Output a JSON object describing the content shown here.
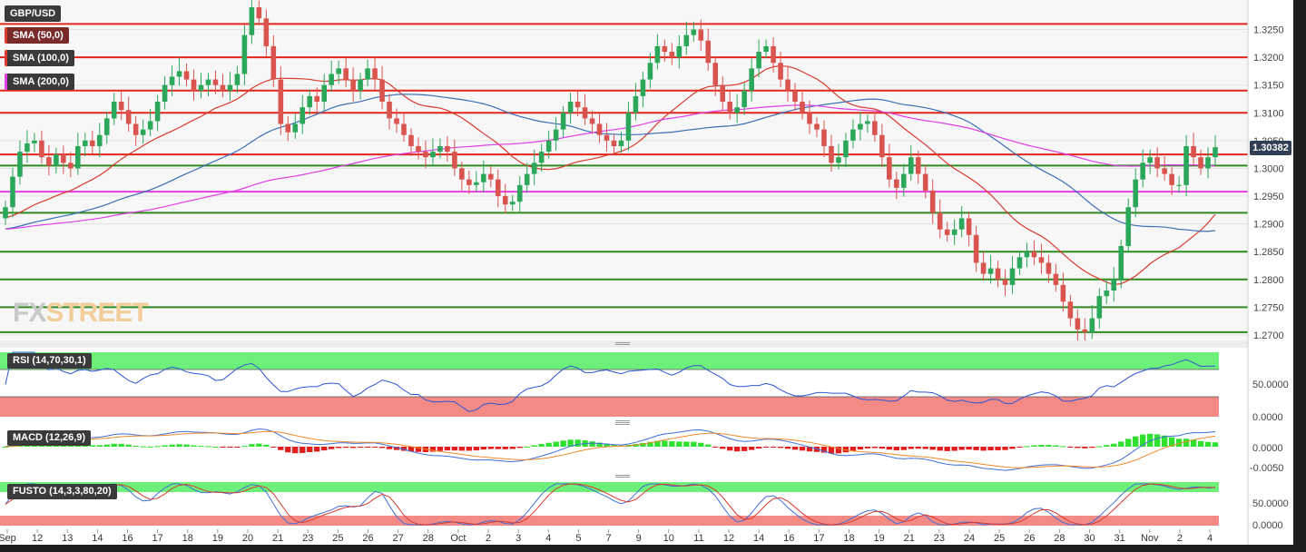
{
  "instrument": "GBP/USD",
  "legend": {
    "sma50": {
      "label": "SMA (50,0)",
      "color": "#d83a2e"
    },
    "sma100": {
      "label": "SMA (100,0)",
      "color": "#3b6fb6"
    },
    "sma200": {
      "label": "SMA (200,0)",
      "color": "#e03ee6"
    }
  },
  "watermark": {
    "part1": "FX",
    "part2": "STREET"
  },
  "last_price": "1.30382",
  "panes": {
    "rsi": {
      "label": "RSI (14,70,30,1)",
      "ticks": [
        "50.0000",
        "0.0000"
      ]
    },
    "macd": {
      "label": "MACD (12,26,9)",
      "ticks": [
        "0.0000",
        "-0.0050"
      ]
    },
    "fusto": {
      "label": "FUSTO (14,3,3,80,20)",
      "ticks": [
        "50.0000",
        "0.0000"
      ]
    }
  },
  "colors": {
    "up": "#2aa75a",
    "down": "#d9534f",
    "hline_red": "#e3261b",
    "hline_green": "#2f8a1f",
    "hline_magenta": "#e53ee0",
    "overbought": "#6cf07a",
    "oversold": "#f38a86",
    "rsi_line": "#2d55d6",
    "macd_line": "#3f6fd8",
    "signal_line": "#f08a2a"
  },
  "chart_data": {
    "type": "candlestick",
    "title": "GBP/USD",
    "ylim": [
      1.2695,
      1.3295
    ],
    "y_ticks": [
      "1.3250",
      "1.3200",
      "1.3150",
      "1.3100",
      "1.3050",
      "1.3000",
      "1.2950",
      "1.2900",
      "1.2850",
      "1.2800",
      "1.2750",
      "1.2700"
    ],
    "x_ticks": [
      "Sep",
      "12",
      "13",
      "14",
      "16",
      "17",
      "18",
      "19",
      "20",
      "21",
      "23",
      "25",
      "26",
      "27",
      "28",
      "Oct",
      "2",
      "3",
      "4",
      "5",
      "7",
      "9",
      "10",
      "11",
      "12",
      "14",
      "16",
      "17",
      "18",
      "19",
      "21",
      "23",
      "24",
      "25",
      "26",
      "28",
      "30",
      "31",
      "Nov",
      "2",
      "4"
    ],
    "horizontal_levels": [
      {
        "value": 1.326,
        "color": "red"
      },
      {
        "value": 1.32,
        "color": "red"
      },
      {
        "value": 1.314,
        "color": "red"
      },
      {
        "value": 1.31,
        "color": "red"
      },
      {
        "value": 1.3025,
        "color": "red"
      },
      {
        "value": 1.3005,
        "color": "green"
      },
      {
        "value": 1.2958,
        "color": "magenta"
      },
      {
        "value": 1.292,
        "color": "green"
      },
      {
        "value": 1.285,
        "color": "green"
      },
      {
        "value": 1.28,
        "color": "green"
      },
      {
        "value": 1.275,
        "color": "green"
      },
      {
        "value": 1.2705,
        "color": "green"
      }
    ],
    "series": [
      {
        "name": "GBP/USD",
        "close": [
          1.293,
          1.2985,
          1.303,
          1.3045,
          1.305,
          1.302,
          1.3005,
          1.3025,
          1.301,
          1.3,
          1.304,
          1.305,
          1.304,
          1.306,
          1.309,
          1.312,
          1.3105,
          1.308,
          1.306,
          1.307,
          1.3085,
          1.312,
          1.315,
          1.3165,
          1.3175,
          1.316,
          1.314,
          1.315,
          1.316,
          1.315,
          1.314,
          1.315,
          1.317,
          1.324,
          1.329,
          1.327,
          1.322,
          1.316,
          1.308,
          1.3065,
          1.308,
          1.311,
          1.313,
          1.312,
          1.315,
          1.317,
          1.318,
          1.316,
          1.314,
          1.316,
          1.318,
          1.316,
          1.312,
          1.309,
          1.308,
          1.306,
          1.304,
          1.303,
          1.302,
          1.303,
          1.304,
          1.303,
          1.3,
          1.298,
          1.297,
          1.2975,
          1.299,
          1.298,
          1.295,
          1.2935,
          1.294,
          1.297,
          1.299,
          1.301,
          1.303,
          1.305,
          1.307,
          1.31,
          1.312,
          1.311,
          1.309,
          1.308,
          1.306,
          1.305,
          1.304,
          1.305,
          1.31,
          1.313,
          1.316,
          1.319,
          1.322,
          1.321,
          1.32,
          1.322,
          1.324,
          1.325,
          1.323,
          1.319,
          1.315,
          1.312,
          1.31,
          1.311,
          1.314,
          1.318,
          1.321,
          1.322,
          1.319,
          1.316,
          1.314,
          1.312,
          1.31,
          1.308,
          1.307,
          1.304,
          1.301,
          1.302,
          1.305,
          1.307,
          1.308,
          1.3085,
          1.306,
          1.302,
          1.298,
          1.2965,
          1.299,
          1.302,
          1.299,
          1.296,
          1.292,
          1.289,
          1.288,
          1.289,
          1.291,
          1.288,
          1.283,
          1.281,
          1.282,
          1.28,
          1.279,
          1.282,
          1.284,
          1.285,
          1.284,
          1.283,
          1.281,
          1.279,
          1.276,
          1.273,
          1.271,
          1.2705,
          1.273,
          1.277,
          1.278,
          1.28,
          1.286,
          1.293,
          1.298,
          1.301,
          1.302,
          1.3,
          1.299,
          1.297,
          1.297,
          1.304,
          1.302,
          1.3,
          1.302,
          1.3038
        ]
      }
    ]
  }
}
